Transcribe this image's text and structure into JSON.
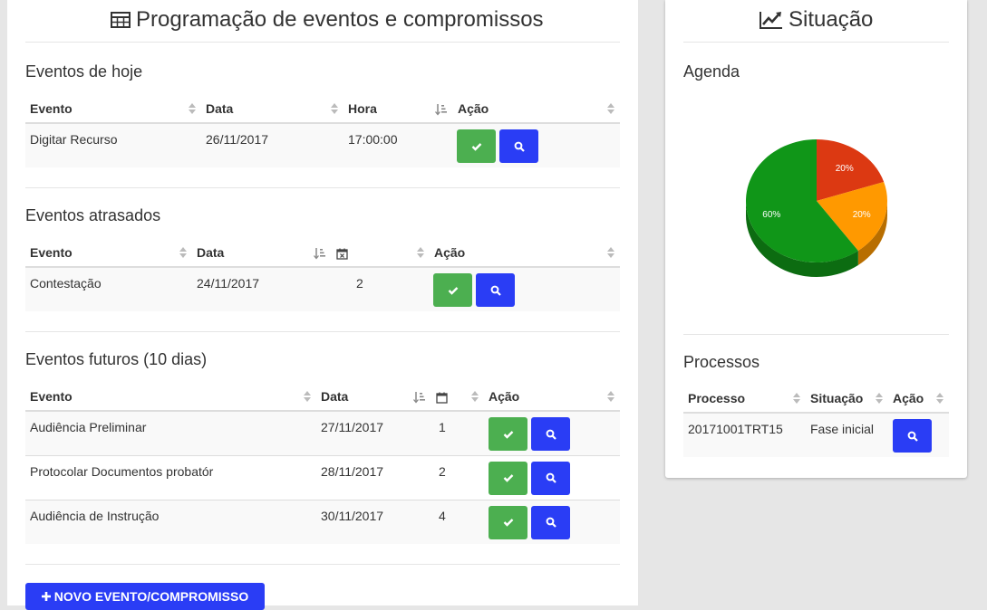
{
  "main": {
    "title": "Programação de eventos e compromissos",
    "today": {
      "title": "Eventos de hoje",
      "headers": [
        "Evento",
        "Data",
        "Hora",
        "Ação"
      ],
      "rows": [
        {
          "evento": "Digitar Recurso",
          "data": "26/11/2017",
          "hora": "17:00:00"
        }
      ]
    },
    "late": {
      "title": "Eventos atrasados",
      "headers": [
        "Evento",
        "Data",
        "Ação"
      ],
      "rows": [
        {
          "evento": "Contestação",
          "data": "24/11/2017",
          "dias": "2"
        }
      ]
    },
    "future": {
      "title": "Eventos futuros (10 dias)",
      "headers": [
        "Evento",
        "Data",
        "Ação"
      ],
      "rows": [
        {
          "evento": "Audiência Preliminar",
          "data": "27/11/2017",
          "dias": "1"
        },
        {
          "evento": "Protocolar Documentos probatór",
          "data": "28/11/2017",
          "dias": "2"
        },
        {
          "evento": "Audiência de Instrução",
          "data": "30/11/2017",
          "dias": "4"
        }
      ]
    },
    "new_button": "NOVO EVENTO/COMPROMISSO"
  },
  "side": {
    "title": "Situação",
    "agenda_title": "Agenda",
    "chart_data": {
      "type": "pie",
      "slices": [
        {
          "label": "20%",
          "value": 20,
          "color": "#dc3912"
        },
        {
          "label": "20%",
          "value": 20,
          "color": "#ff9900"
        },
        {
          "label": "60%",
          "value": 60,
          "color": "#109618"
        }
      ]
    },
    "processos": {
      "title": "Processos",
      "headers": [
        "Processo",
        "Situação",
        "Ação"
      ],
      "rows": [
        {
          "processo": "20171001TRT15",
          "situacao": "Fase inicial"
        }
      ]
    }
  }
}
